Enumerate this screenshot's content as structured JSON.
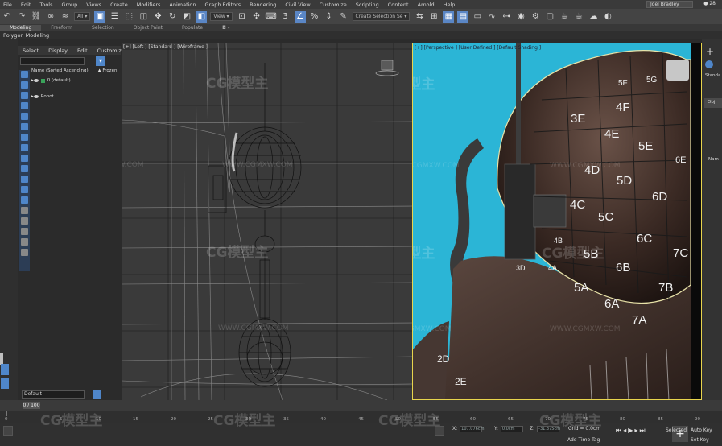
{
  "menubar": {
    "items": [
      "File",
      "Edit",
      "Tools",
      "Group",
      "Views",
      "Create",
      "Modifiers",
      "Animation",
      "Graph Editors",
      "Rendering",
      "Civil View",
      "Customize",
      "Scripting",
      "Content",
      "Arnold",
      "Help"
    ],
    "user": "Joel Bradley",
    "help_count": "28"
  },
  "toolbar": {
    "filter_value": "All",
    "view_value": "View",
    "selection_set": "Create Selection Se"
  },
  "ribbon": {
    "tabs": [
      "Modeling",
      "Freeform",
      "Selection",
      "Object Paint",
      "Populate"
    ],
    "sub_label": "Polygon Modeling"
  },
  "scene_explorer": {
    "menu": [
      "Select",
      "Display",
      "Edit",
      "Customize"
    ],
    "column_name": "Name (Sorted Ascending)",
    "column_frozen": "▲ Frozen",
    "rows": [
      {
        "label": "0 (default)"
      },
      {
        "label": "Robot"
      }
    ],
    "layer_dropdown": "Default"
  },
  "viewports": {
    "left_label": "[+] [Left ] [Standard ] [Wireframe ]",
    "right_label": "[+] [Perspective ] [User Defined ] [Default Shading ]",
    "uv_tiles": [
      "5F",
      "5G",
      "3E",
      "4F",
      "4E",
      "5E",
      "4D",
      "5D",
      "6D",
      "6E",
      "4C",
      "5C",
      "6C",
      "5B",
      "6B",
      "7C",
      "5A",
      "6A",
      "7A",
      "7B",
      "2D",
      "2E",
      "3D",
      "4B",
      "4A"
    ]
  },
  "command_panel": {
    "standard": "Standa",
    "object_type": "Obj",
    "name": "Nam"
  },
  "timeline": {
    "frame": "0 / 100",
    "ticks": [
      "0",
      "5",
      "10",
      "15",
      "20",
      "25",
      "30",
      "35",
      "40",
      "45",
      "50",
      "55",
      "60",
      "65",
      "70",
      "75",
      "80",
      "85",
      "90"
    ]
  },
  "statusbar": {
    "x_label": "X:",
    "x_value": "107.076cm",
    "y_label": "Y:",
    "y_value": "0.0cm",
    "z_label": "Z:",
    "z_value": "-31.375cm",
    "grid": "Grid = 0.0cm",
    "add_time_tag": "Add Time Tag",
    "auto_key": "Auto Key",
    "set_key": "Set Key",
    "selected": "Selected"
  },
  "watermarks": {
    "brand": "CG模型主",
    "url": "WWW.CGMXW.COM"
  }
}
